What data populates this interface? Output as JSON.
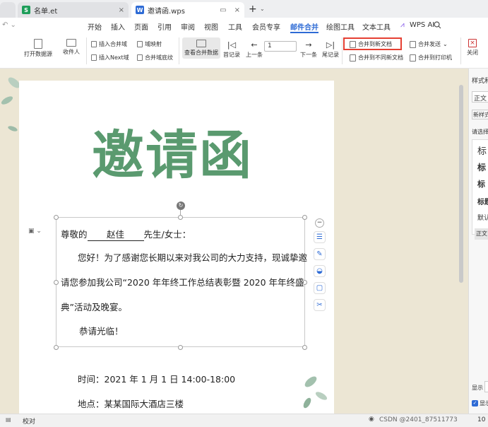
{
  "tabs": [
    {
      "label": "",
      "tag": ""
    },
    {
      "label": "名单.et",
      "tag": "S"
    },
    {
      "label": "邀请函.wps",
      "tag": "W"
    }
  ],
  "new_tab": "+",
  "menu": [
    "开始",
    "插入",
    "页面",
    "引用",
    "审阅",
    "视图",
    "工具",
    "会员专享",
    "邮件合并",
    "绘图工具",
    "文本工具",
    "WPS AI"
  ],
  "ribbon": {
    "open_source": "打开数据源",
    "recipients": "收件人",
    "insert_field": "插入合并域",
    "field_map": "域映射",
    "insert_next": "插入Next域",
    "highlight": "合并域底纹",
    "view_data": "查看合并数据",
    "first": "首记录",
    "prev": "上一条",
    "record": "1",
    "next": "下一条",
    "last": "尾记录",
    "merge_new": "合并到新文档",
    "merge_diff": "合并到不同新文档",
    "merge_send": "合并发送",
    "merge_print": "合并到打印机",
    "close": "关闭"
  },
  "doc": {
    "title": "邀请函",
    "greeting_pre": "尊敬的",
    "name": "赵佳",
    "greeting_post": "先生/女士：",
    "para1": "您好！为了感谢您长期以来对我公司的大力支持，现诚挚邀",
    "para2": "请您参加我公司“2020 年年终工作总结表彰暨 2020 年年终盛",
    "para3": "典”活动及晚宴。",
    "sign": "恭请光临！",
    "time": "时间：2021 年 1 月 1 日     14:00-18:00",
    "place": "地点：某某国际大酒店三楼"
  },
  "right_pane": {
    "header": "样式和",
    "style1": "正文",
    "new_style": "新样式",
    "select_label": "请选择",
    "h1": "标",
    "h2": "标",
    "h3": "标",
    "h4": "标题",
    "default": "默认",
    "normal": "正文",
    "show": "显示",
    "show2": "显示"
  },
  "status": {
    "proof": "校对",
    "watermark": "CSDN @2401_87511773",
    "zoom": "10"
  },
  "colors": {
    "accent": "#2e6bd5",
    "title_green": "#5a9a6f",
    "highlight_red": "#e54033"
  }
}
